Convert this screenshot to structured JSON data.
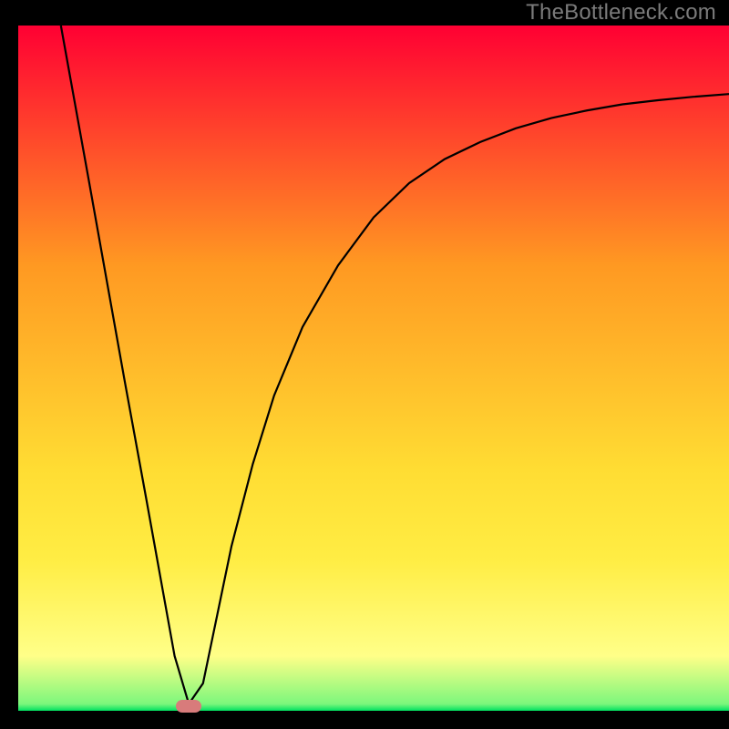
{
  "watermark": "TheBottleneck.com",
  "chart_data": {
    "type": "line",
    "title": "",
    "xlabel": "",
    "ylabel": "",
    "xlim": [
      0,
      100
    ],
    "ylim": [
      0,
      100
    ],
    "grid": false,
    "legend": false,
    "background_gradient": {
      "top": "#ff0033",
      "mid_upper": "#ff9922",
      "mid": "#ffed44",
      "mid_lower": "#ffff88",
      "bottom": "#00e060"
    },
    "series": [
      {
        "name": "bottleneck-curve",
        "color": "#000000",
        "x": [
          6,
          10,
          15,
          18,
          20,
          22,
          24,
          26,
          28,
          30,
          33,
          36,
          40,
          45,
          50,
          55,
          60,
          65,
          70,
          75,
          80,
          85,
          90,
          95,
          100
        ],
        "y": [
          100,
          77,
          48,
          31,
          19.5,
          8,
          1,
          4,
          14,
          24,
          36,
          46,
          56,
          65,
          72,
          77,
          80.5,
          83,
          85,
          86.5,
          87.6,
          88.5,
          89.1,
          89.6,
          90
        ]
      }
    ],
    "marker": {
      "name": "optimal-point",
      "x": 24,
      "y": 0.7,
      "color": "#d87b7b"
    },
    "plot_frame": {
      "axis_thickness_left": 20,
      "axis_thickness_bottom": 20
    }
  }
}
